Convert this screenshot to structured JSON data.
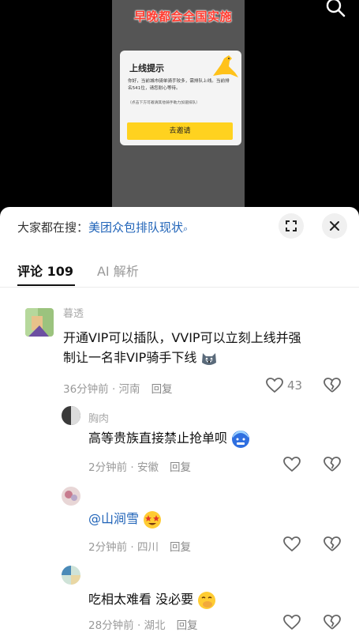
{
  "video": {
    "banner": "早晚都会全国实施",
    "popup": {
      "title": "上线提示",
      "body": "你好，当前城市骑单骑手较多，需排队上线。当前排名541位，请您耐心等待。",
      "note": "（点击下方可邀请其他骑手助力加速排队）",
      "button": "去邀请"
    }
  },
  "panel": {
    "search_label": "大家都在搜：",
    "search_query": "美团众包排队现状",
    "tabs": [
      {
        "label": "评论 109",
        "active": true
      },
      {
        "label": "AI 解析",
        "active": false
      }
    ]
  },
  "comments": [
    {
      "user": "暮透",
      "text_line1": "开通VIP可以插队，VVIP可以立刻上线并强",
      "text_line2": "制让一名非VIP骑手下线",
      "emoji": "husky",
      "time": "36分钟前 · 河南",
      "reply": "回复",
      "likes": "43"
    },
    {
      "user": "胸肉",
      "text": "高等贵族直接禁止抢单呗",
      "emoji": "cold-face",
      "time": "2分钟前 · 安徽",
      "reply": "回复"
    },
    {
      "user": "",
      "text": "@山涧雪",
      "emoji": "star-struck",
      "time": "2分钟前 · 四川",
      "reply": "回复"
    },
    {
      "user": "",
      "text": "吃相太难看 没必要",
      "emoji": "hand-over-mouth",
      "time": "28分钟前 · 湖北",
      "reply": "回复"
    }
  ]
}
